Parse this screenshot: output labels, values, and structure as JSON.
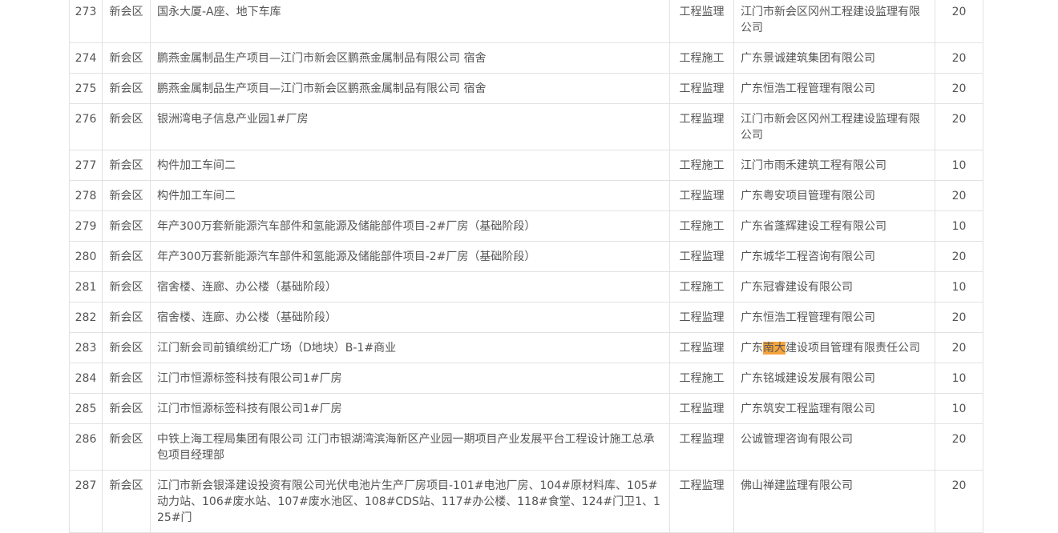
{
  "rows": [
    {
      "no": "273",
      "area": "新会区",
      "project": "国永大厦-A座、地下车库",
      "type": "工程监理",
      "company": "江门市新会区冈州工程建设监理有限公司",
      "score": "20"
    },
    {
      "no": "274",
      "area": "新会区",
      "project": "鹏燕金属制品生产项目—江门市新会区鹏燕金属制品有限公司 宿舍",
      "type": "工程施工",
      "company": "广东景诚建筑集团有限公司",
      "score": "20"
    },
    {
      "no": "275",
      "area": "新会区",
      "project": "鹏燕金属制品生产项目—江门市新会区鹏燕金属制品有限公司 宿舍",
      "type": "工程监理",
      "company": "广东恒浩工程管理有限公司",
      "score": "20"
    },
    {
      "no": "276",
      "area": "新会区",
      "project": "银洲湾电子信息产业园1#厂房",
      "type": "工程监理",
      "company": "江门市新会区冈州工程建设监理有限公司",
      "score": "20"
    },
    {
      "no": "277",
      "area": "新会区",
      "project": "构件加工车间二",
      "type": "工程施工",
      "company": "江门市雨禾建筑工程有限公司",
      "score": "10"
    },
    {
      "no": "278",
      "area": "新会区",
      "project": "构件加工车间二",
      "type": "工程监理",
      "company": "广东粤安项目管理有限公司",
      "score": "20"
    },
    {
      "no": "279",
      "area": "新会区",
      "project": "年产300万套新能源汽车部件和氢能源及储能部件项目-2#厂房（基础阶段）",
      "type": "工程施工",
      "company": "广东省蓬辉建设工程有限公司",
      "score": "10"
    },
    {
      "no": "280",
      "area": "新会区",
      "project": "年产300万套新能源汽车部件和氢能源及储能部件项目-2#厂房（基础阶段）",
      "type": "工程监理",
      "company": "广东城华工程咨询有限公司",
      "score": "20"
    },
    {
      "no": "281",
      "area": "新会区",
      "project": "宿舍楼、连廊、办公楼（基础阶段）",
      "type": "工程施工",
      "company": "广东冠睿建设有限公司",
      "score": "10"
    },
    {
      "no": "282",
      "area": "新会区",
      "project": "宿舍楼、连廊、办公楼（基础阶段）",
      "type": "工程监理",
      "company": "广东恒浩工程管理有限公司",
      "score": "20"
    },
    {
      "no": "283",
      "area": "新会区",
      "project": "江门新会司前镇缤纷汇广场（D地块）B-1#商业",
      "type": "工程监理",
      "company": "广东南大建设项目管理有限责任公司",
      "company_pre": "广东",
      "company_hl": "南大",
      "company_post": "建设项目管理有限责任公司",
      "score": "20"
    },
    {
      "no": "284",
      "area": "新会区",
      "project": "江门市恒源标签科技有限公司1#厂房",
      "type": "工程施工",
      "company": "广东铭城建设发展有限公司",
      "score": "10"
    },
    {
      "no": "285",
      "area": "新会区",
      "project": "江门市恒源标签科技有限公司1#厂房",
      "type": "工程监理",
      "company": "广东筑安工程监理有限公司",
      "score": "10"
    },
    {
      "no": "286",
      "area": "新会区",
      "project": "中铁上海工程局集团有限公司 江门市银湖湾滨海新区产业园一期项目产业发展平台工程设计施工总承包项目经理部",
      "type": "工程监理",
      "company": "公诚管理咨询有限公司",
      "score": "20"
    },
    {
      "no": "287",
      "area": "新会区",
      "project": "江门市新会银泽建设投资有限公司光伏电池片生产厂房项目-101#电池厂房、104#原材料库、105#动力站、106#废水站、107#废水池区、108#CDS站、117#办公楼、118#食堂、124#门卫1、125#门",
      "type": "工程监理",
      "company": "佛山禅建监理有限公司",
      "score": "20"
    }
  ]
}
